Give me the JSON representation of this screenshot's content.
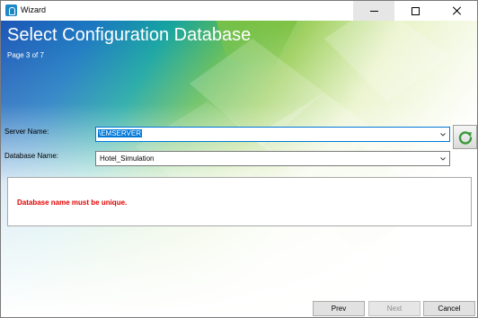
{
  "window": {
    "title": "Wizard"
  },
  "titlebar": {
    "minimize_icon": "minimize-icon",
    "maximize_icon": "maximize-icon",
    "close_icon": "close-icon"
  },
  "header": {
    "title": "Select Configuration Database",
    "page_indicator": "Page 3 of 7"
  },
  "form": {
    "server_label": "Server Name:",
    "server_value": "\\EMSERVER",
    "database_label": "Database Name:",
    "database_value": "Hotel_Simulation",
    "refresh_icon": "refresh-icon"
  },
  "message": {
    "text": "Database name must be unique.",
    "color": "#e00000"
  },
  "footer": {
    "prev_label": "Prev",
    "next_label": "Next",
    "cancel_label": "Cancel",
    "next_disabled": true
  },
  "colors": {
    "accent": "#0078d7",
    "brand_green": "#7cc242",
    "brand_teal": "#0d8f86",
    "brand_blue": "#1463b3"
  }
}
